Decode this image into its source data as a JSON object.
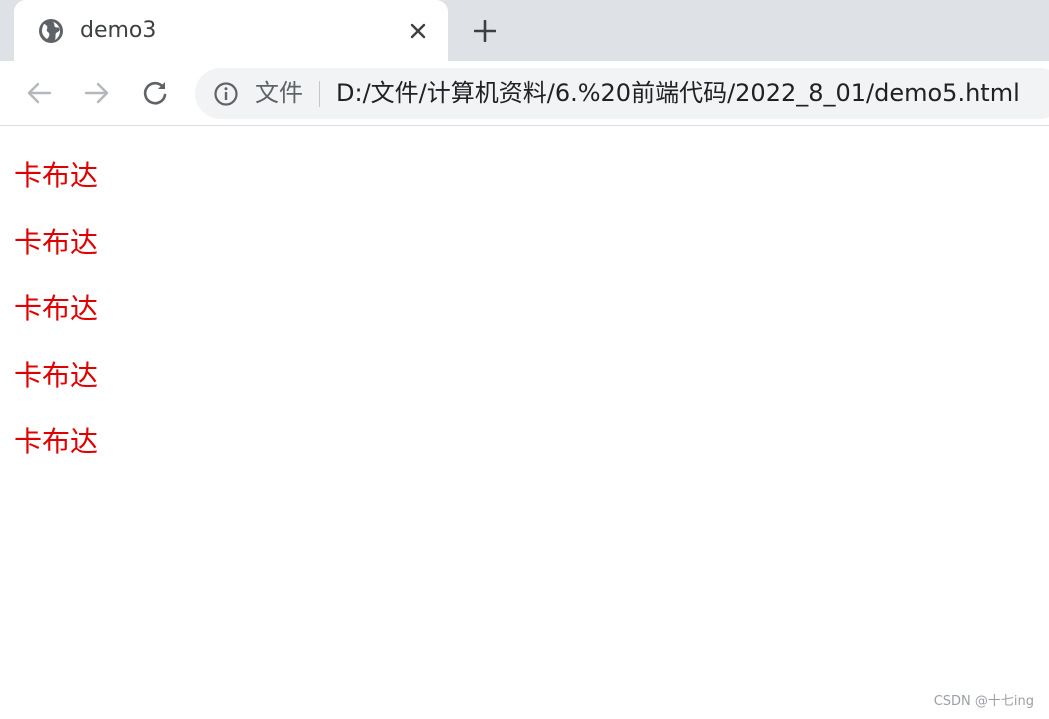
{
  "tab": {
    "title": "demo3",
    "favicon": "globe-icon"
  },
  "toolbar": {
    "back_icon": "arrow-left-icon",
    "forward_icon": "arrow-right-icon",
    "reload_icon": "reload-icon"
  },
  "omnibox": {
    "info_icon": "info-icon",
    "security_label": "文件",
    "url": "D:/文件/计算机资料/6.%20前端代码/2022_8_01/demo5.html"
  },
  "content": {
    "text_color": "#e10000",
    "paragraphs": [
      "卡布达",
      "卡布达",
      "卡布达",
      "卡布达",
      "卡布达"
    ]
  },
  "watermark": "CSDN @十七ing",
  "colors": {
    "tab_strip": "#dee1e6",
    "omnibox": "#f1f3f4",
    "icon": "#5f6368",
    "icon_disabled": "#b4b7bb"
  }
}
